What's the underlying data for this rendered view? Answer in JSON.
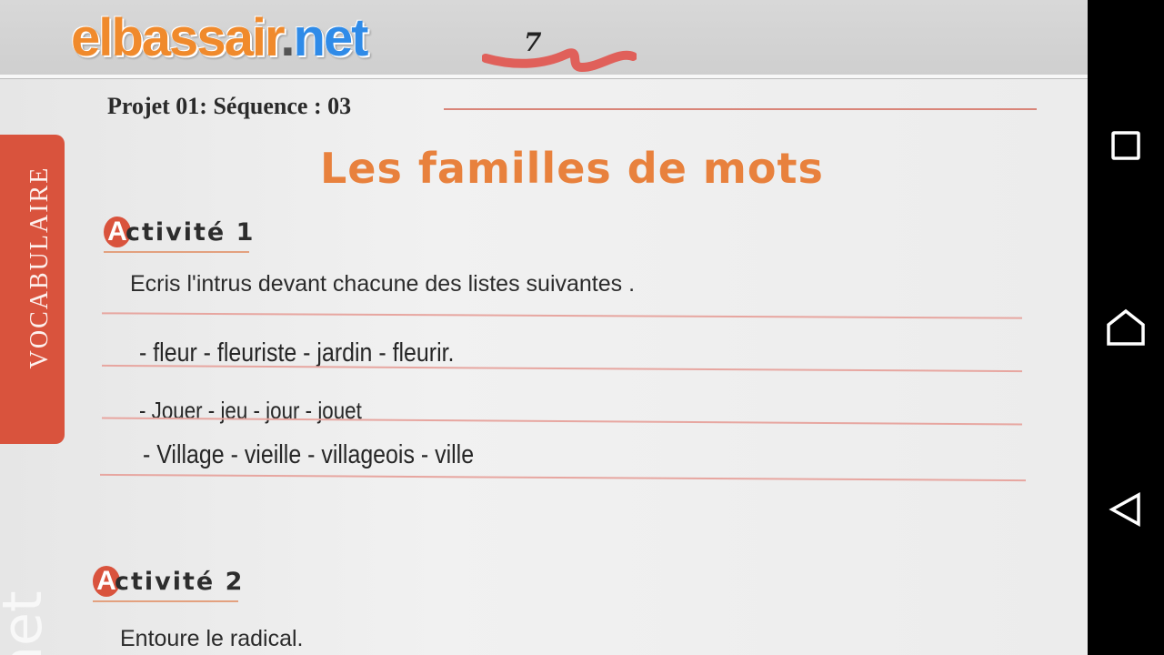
{
  "banner": {
    "logo_part1": "elbassair",
    "logo_dot": ".",
    "logo_part2": "net",
    "page_number": "7"
  },
  "document": {
    "header": "Projet 01:  Séquence : 03",
    "section_tab": "VOCABULAIRE",
    "title": "Les familles de mots",
    "activities": [
      {
        "badge": "A",
        "label": "ctivité  1",
        "instruction": "Ecris l'intrus devant chacune des listes suivantes .",
        "lists": [
          "- fleur - fleuriste - jardin - fleurir.",
          "- Jouer - jeu - jour - jouet",
          "- Village - vieille - villageois - ville"
        ]
      },
      {
        "badge": "A",
        "label": "ctivité  2",
        "instruction": "Entoure le radical."
      }
    ],
    "watermark": "net"
  },
  "nav": {
    "buttons": [
      "recents-icon",
      "home-icon",
      "back-icon"
    ]
  },
  "colors": {
    "title_orange": "#e8813d",
    "tab_red": "#d9533d",
    "logo_blue": "#2f8be8",
    "logo_orange": "#f08a2c",
    "rule_pink": "#e7a6a0"
  }
}
